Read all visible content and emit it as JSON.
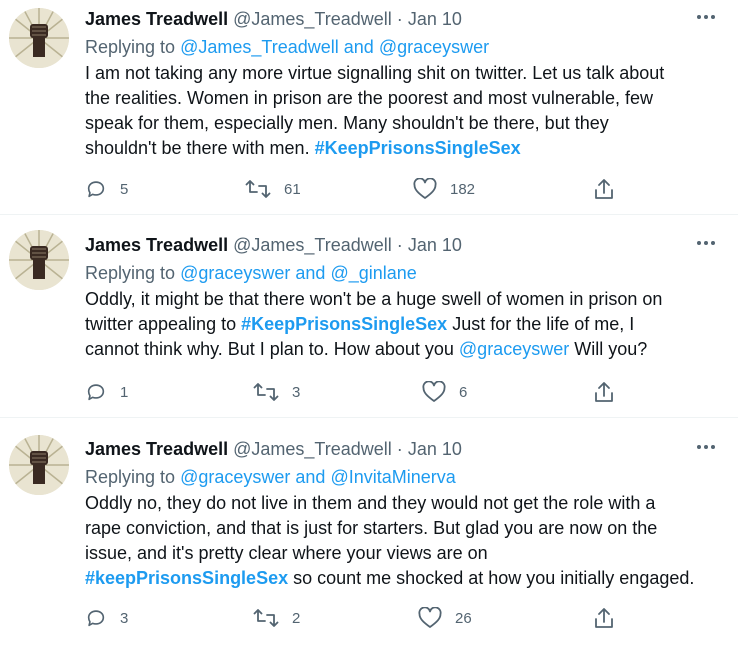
{
  "tweets": [
    {
      "name": "James Treadwell",
      "handle": "@James_Treadwell",
      "separator": "·",
      "date": "Jan 10",
      "replying_prefix": "Replying to",
      "replying_to_1": "@James_Treadwell",
      "replying_and": "and",
      "replying_to_2": "@graceyswer",
      "lines": [
        "I am not taking any more virtue signalling shit on twitter. Let us talk about",
        "the realities. Women in prison are the poorest and most vulnerable, few",
        "speak for them, especially men. Many shouldn't be there, but they",
        "shouldn't be there with men."
      ],
      "line4_hashtag": "#KeepPrisonsSingleSex",
      "replies": "5",
      "retweets": "61",
      "likes": "182"
    },
    {
      "name": "James Treadwell",
      "handle": "@James_Treadwell",
      "separator": "·",
      "date": "Jan 10",
      "replying_prefix": "Replying to",
      "replying_to_1": "@graceyswer",
      "replying_and": "and",
      "replying_to_2": "@_ginlane",
      "line1": "Oddly, it might be that there won't be a huge swell of women in prison on",
      "line2_pre": "twitter appealing to",
      "line2_hashtag": "#KeepPrisonsSingleSex",
      "line2_post": "Just for the life of me, I",
      "line3_pre": "cannot think why. But I plan to. How about you",
      "line3_mention": "@graceyswer",
      "line3_post": "Will you?",
      "replies": "1",
      "retweets": "3",
      "likes": "6"
    },
    {
      "name": "James Treadwell",
      "handle": "@James_Treadwell",
      "separator": "·",
      "date": "Jan 10",
      "replying_prefix": "Replying to",
      "replying_to_1": "@graceyswer",
      "replying_and": "and",
      "replying_to_2": "@InvitaMinerva",
      "lines": [
        "Oddly no, they do not live in them and they would not get the role with a",
        "rape conviction, and that is just for starters. But glad you are now on the",
        "issue, and it's pretty clear where your views are on"
      ],
      "line4_hashtag": "#keepPrisonsSingleSex",
      "line4_post": "so count me shocked at how you initially engaged.",
      "replies": "3",
      "retweets": "2",
      "likes": "26"
    }
  ]
}
